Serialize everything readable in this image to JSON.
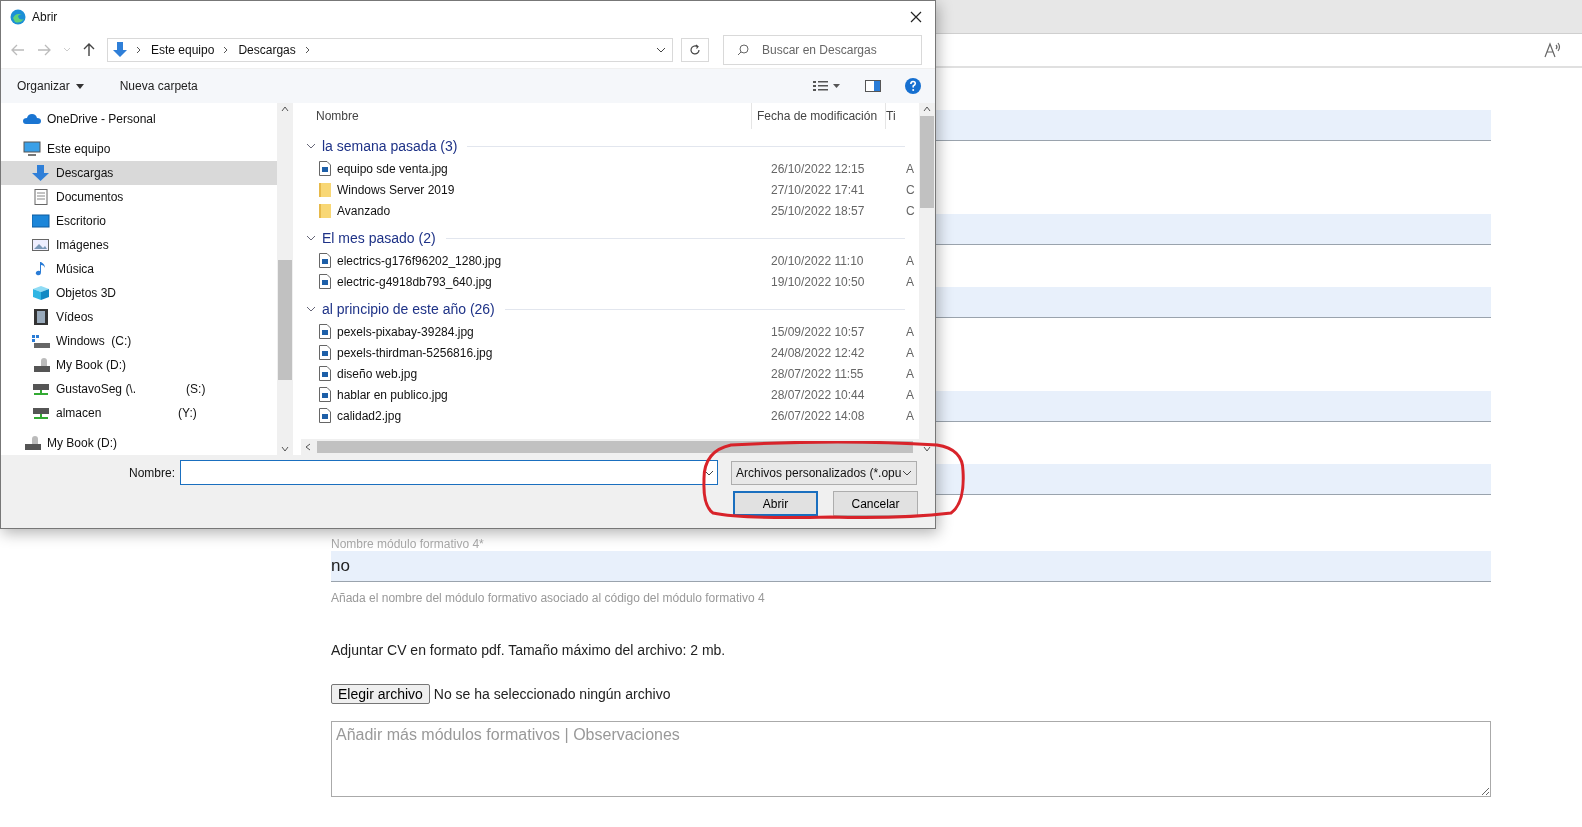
{
  "browser": {
    "form": {
      "label": "Nombre módulo formativo 4*",
      "value": "no",
      "help": "Añada el nombre del módulo formativo asociado al código del módulo formativo 4",
      "attach_text": "Adjuntar CV en formato pdf. Tamaño máximo del archivo: 2 mb.",
      "file_button": "Elegir archivo",
      "file_status": "No se ha seleccionado ningún archivo",
      "notes_placeholder": "Añadir más módulos formativos | Observaciones"
    }
  },
  "dialog": {
    "title": "Abrir",
    "breadcrumbs": [
      "Este equipo",
      "Descargas"
    ],
    "search": {
      "placeholder": "Buscar en Descargas"
    },
    "toolbar": {
      "organize": "Organizar",
      "new_folder": "Nueva carpeta"
    },
    "nav": [
      {
        "label": "OneDrive - Personal",
        "kind": "cloud",
        "selected": false
      },
      {
        "label": "Este equipo",
        "kind": "computer",
        "selected": false,
        "children": [
          {
            "label": "Descargas",
            "kind": "download",
            "selected": true
          },
          {
            "label": "Documentos",
            "kind": "documents",
            "selected": false
          },
          {
            "label": "Escritorio",
            "kind": "desktop",
            "selected": false
          },
          {
            "label": "Imágenes",
            "kind": "pictures",
            "selected": false
          },
          {
            "label": "Música",
            "kind": "music",
            "selected": false
          },
          {
            "label": "Objetos 3D",
            "kind": "cube",
            "selected": false
          },
          {
            "label": "Vídeos",
            "kind": "video",
            "selected": false
          },
          {
            "label": "Windows  (C:)",
            "kind": "system-drive",
            "selected": false
          },
          {
            "label": "My Book (D:)",
            "kind": "drive",
            "selected": false
          },
          {
            "label": "GustavoSeg (\\.               (S:)",
            "kind": "network",
            "selected": false
          },
          {
            "label": "almacen                       (Y:)",
            "kind": "network",
            "selected": false
          }
        ]
      },
      {
        "label": "My Book (D:)",
        "kind": "drive",
        "selected": false
      }
    ],
    "columns": [
      "Nombre",
      "Fecha de modificación",
      "Ti"
    ],
    "groups": [
      {
        "title": "la semana pasada (3)",
        "expanded": true,
        "files": [
          {
            "name": "equipo sde venta.jpg",
            "kind": "image",
            "date": "26/10/2022 12:15",
            "type": "A"
          },
          {
            "name": "Windows Server 2019",
            "kind": "folder",
            "date": "27/10/2022 17:41",
            "type": "C"
          },
          {
            "name": "Avanzado",
            "kind": "folder",
            "date": "25/10/2022 18:57",
            "type": "C"
          }
        ]
      },
      {
        "title": "El mes pasado (2)",
        "expanded": true,
        "files": [
          {
            "name": "electrics-g176f96202_1280.jpg",
            "kind": "image",
            "date": "20/10/2022 11:10",
            "type": "A"
          },
          {
            "name": "electric-g4918db793_640.jpg",
            "kind": "image",
            "date": "19/10/2022 10:50",
            "type": "A"
          }
        ]
      },
      {
        "title": "al principio de este año (26)",
        "expanded": true,
        "files": [
          {
            "name": "pexels-pixabay-39284.jpg",
            "kind": "image",
            "date": "15/09/2022 10:57",
            "type": "A"
          },
          {
            "name": "pexels-thirdman-5256816.jpg",
            "kind": "image",
            "date": "24/08/2022 12:42",
            "type": "A"
          },
          {
            "name": "diseño web.jpg",
            "kind": "image",
            "date": "28/07/2022 11:55",
            "type": "A"
          },
          {
            "name": "hablar en publico.jpg",
            "kind": "image",
            "date": "28/07/2022 10:44",
            "type": "A"
          },
          {
            "name": "calidad2.jpg",
            "kind": "image",
            "date": "26/07/2022 14:08",
            "type": "A"
          }
        ]
      }
    ],
    "filename_label": "Nombre:",
    "filetype": "Archivos personalizados (*.opu",
    "buttons": [
      {
        "label": "Abrir",
        "default": true
      },
      {
        "label": "Cancelar",
        "default": false
      }
    ]
  }
}
